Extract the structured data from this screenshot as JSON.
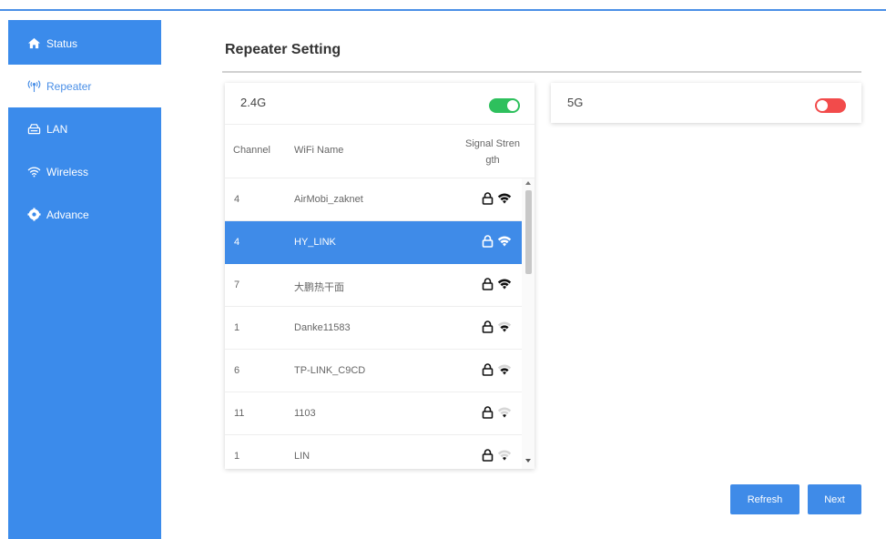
{
  "sidebar": {
    "items": [
      {
        "label": "Status",
        "icon": "home-icon",
        "active": false
      },
      {
        "label": "Repeater",
        "icon": "antenna-icon",
        "active": true
      },
      {
        "label": "LAN",
        "icon": "router-icon",
        "active": false
      },
      {
        "label": "Wireless",
        "icon": "wifi-icon",
        "active": false
      },
      {
        "label": "Advance",
        "icon": "gear-icon",
        "active": false
      }
    ]
  },
  "page": {
    "title": "Repeater Setting"
  },
  "band24": {
    "label": "2.4G",
    "enabled": true,
    "columns": {
      "channel": "Channel",
      "name": "WiFi Name",
      "signal": "Signal Strength"
    },
    "networks": [
      {
        "channel": "4",
        "name": "AirMobi_zaknet",
        "secured": true,
        "signal_bars": 4,
        "selected": false
      },
      {
        "channel": "4",
        "name": "HY_LINK",
        "secured": true,
        "signal_bars": 4,
        "selected": true
      },
      {
        "channel": "7",
        "name": "大鹏热干面",
        "secured": true,
        "signal_bars": 4,
        "selected": false
      },
      {
        "channel": "1",
        "name": "Danke11583",
        "secured": true,
        "signal_bars": 3,
        "selected": false
      },
      {
        "channel": "6",
        "name": "TP-LINK_C9CD",
        "secured": true,
        "signal_bars": 3,
        "selected": false
      },
      {
        "channel": "11",
        "name": "1103",
        "secured": true,
        "signal_bars": 2,
        "selected": false
      },
      {
        "channel": "1",
        "name": "LIN",
        "secured": true,
        "signal_bars": 2,
        "selected": false
      }
    ]
  },
  "band5": {
    "label": "5G",
    "enabled": false
  },
  "buttons": {
    "refresh": "Refresh",
    "next": "Next"
  },
  "colors": {
    "primary": "#3b8beb",
    "toggle_on": "#2ec05d",
    "toggle_off": "#f24b4b"
  }
}
